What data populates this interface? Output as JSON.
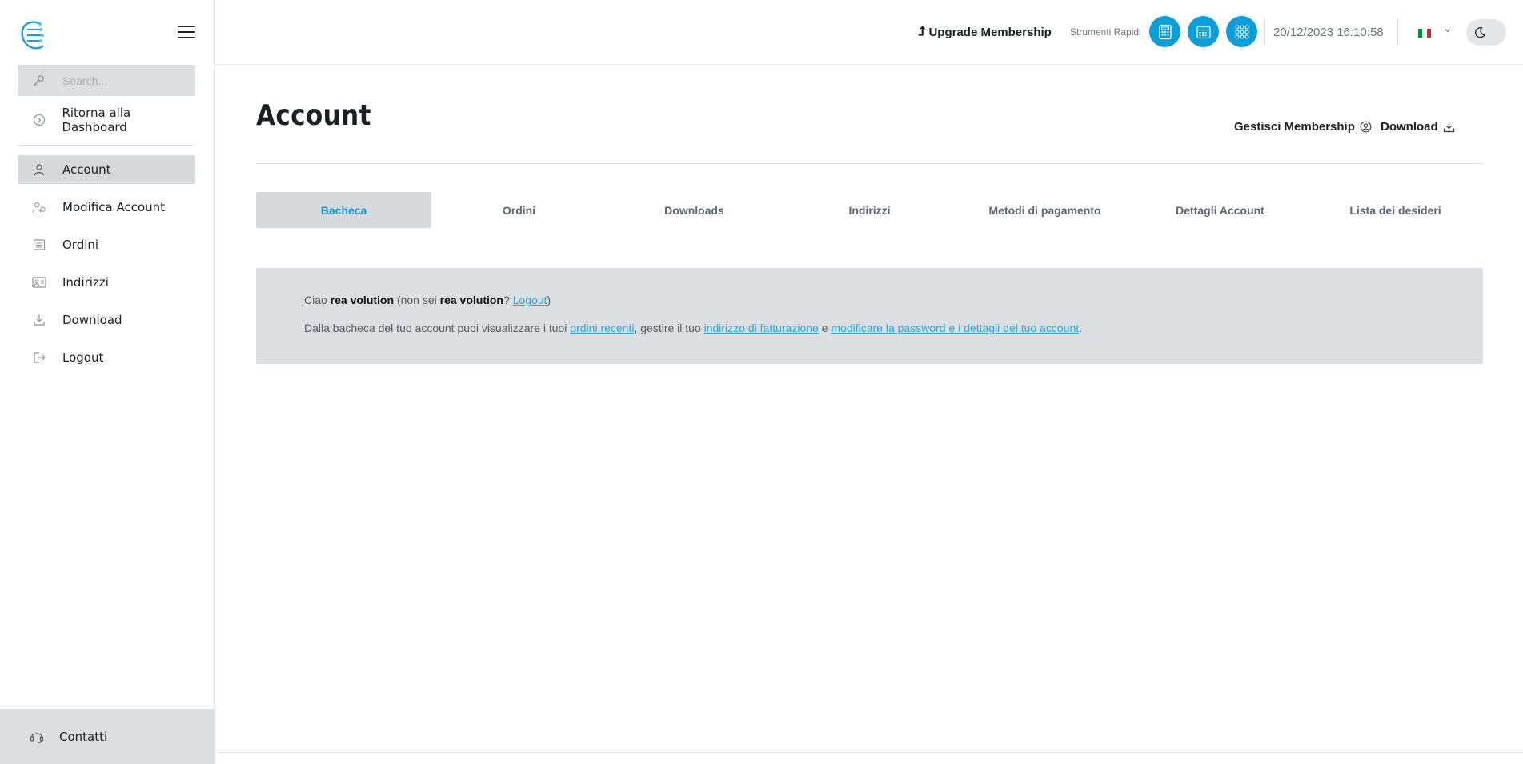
{
  "sidebar": {
    "search_placeholder": "Search...",
    "back_label": "Ritorna alla Dashboard",
    "items": [
      {
        "label": "Account",
        "icon": "user-icon"
      },
      {
        "label": "Modifica Account",
        "icon": "user-edit-icon"
      },
      {
        "label": "Ordini",
        "icon": "orders-icon"
      },
      {
        "label": "Indirizzi",
        "icon": "address-card-icon"
      },
      {
        "label": "Download",
        "icon": "download-icon"
      },
      {
        "label": "Logout",
        "icon": "logout-icon"
      }
    ],
    "contact_label": "Contatti"
  },
  "topbar": {
    "upgrade_label": "Upgrade Membership",
    "tools_label": "Strumenti Rapidi",
    "tools": [
      "calculator-icon",
      "calendar-icon",
      "apps-grid-icon"
    ],
    "datetime": "20/12/2023 16:10:58",
    "language_icon": "italy-flag-icon"
  },
  "main": {
    "title": "Account",
    "manage_membership_label": "Gestisci Membership",
    "download_label": "Download",
    "tabs": [
      "Bacheca",
      "Ordini",
      "Downloads",
      "Indirizzi",
      "Metodi di pagamento",
      "Dettagli Account",
      "Lista dei desideri"
    ],
    "greeting": {
      "hello": "Ciao",
      "username": "rea volution",
      "not_you_prefix": "(non sei",
      "not_you_user": "rea volution",
      "question": "?",
      "logout_link": "Logout",
      "close": ")"
    },
    "description": {
      "intro": "Dalla bacheca del tuo account puoi visualizzare i tuoi",
      "link_orders": "ordini recenti",
      "mid1": ", gestire il tuo",
      "link_billing": "indirizzo di fatturazione",
      "mid2": "e",
      "link_password": "modificare la password e i dettagli del tuo account",
      "end": "."
    }
  },
  "colors": {
    "accent": "#0d9ed8",
    "panel_bg": "#dcdfe2",
    "link": "#27a6dd"
  }
}
